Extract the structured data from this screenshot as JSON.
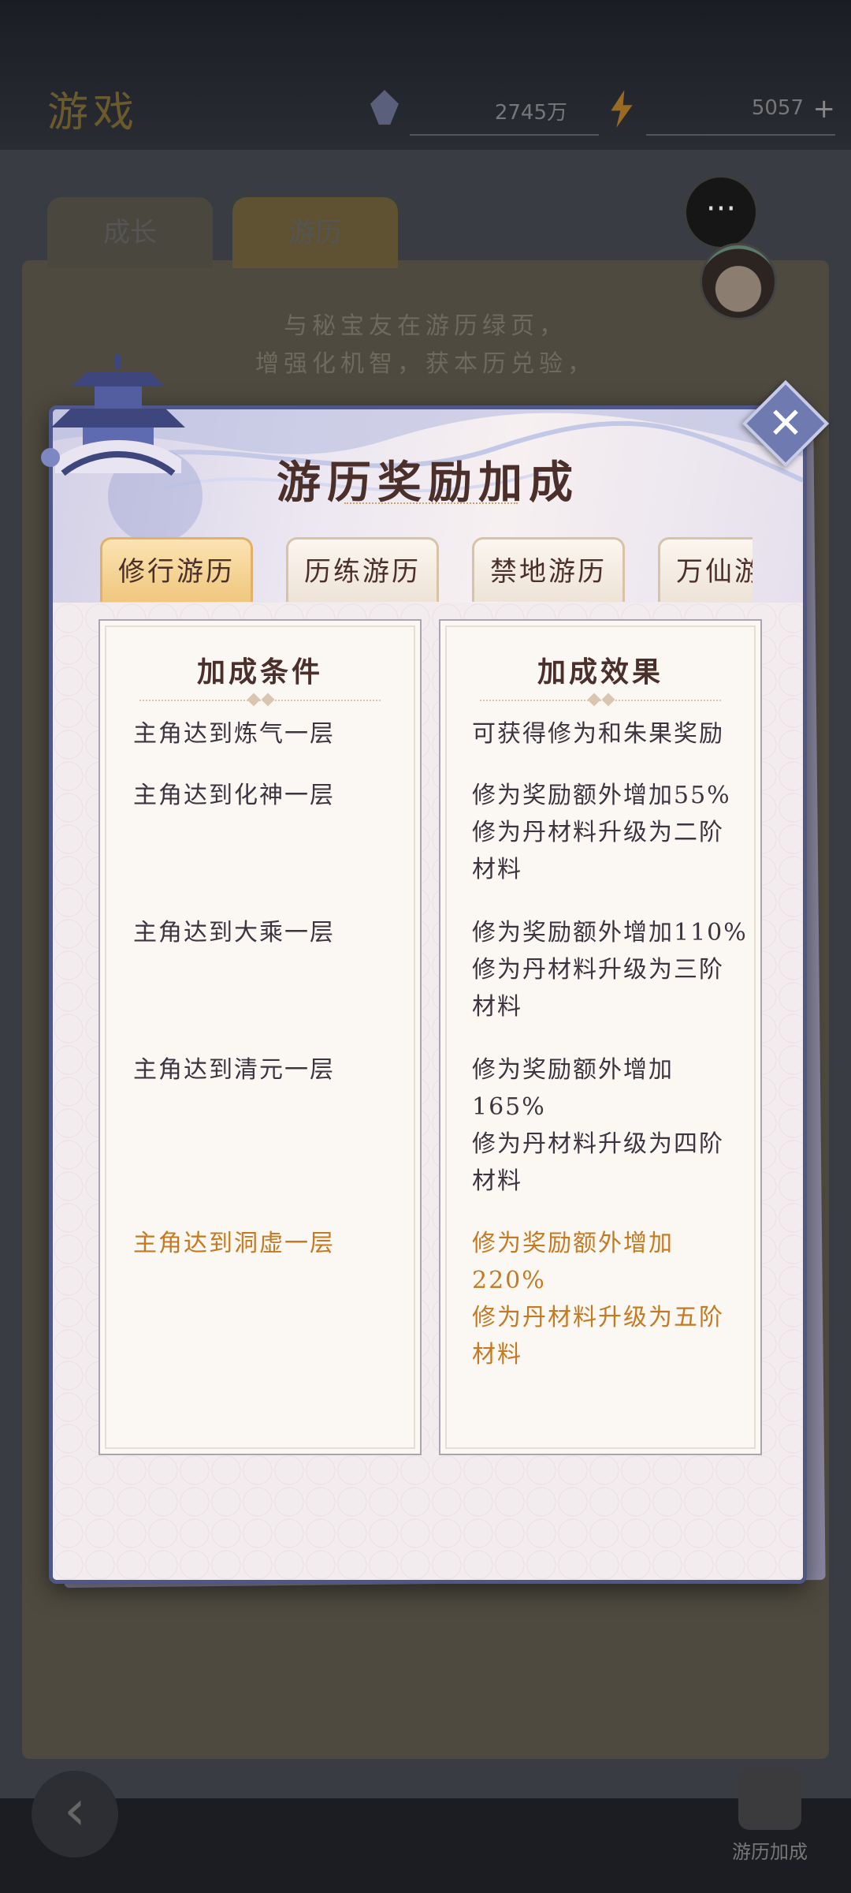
{
  "background": {
    "title": "游戏",
    "resource_1": "2745万",
    "resource_2": "5057",
    "tabs": [
      "成长",
      "游历"
    ],
    "hint_lines": [
      "与秘宝友在游历绿页，",
      "增强化机智，获本历兑验，"
    ],
    "travel_button_label": "游历加成"
  },
  "modal": {
    "title": "游历奖励加成",
    "close_icon": "close-icon",
    "tabs": [
      {
        "label": "修行游历",
        "active": true
      },
      {
        "label": "历练游历",
        "active": false
      },
      {
        "label": "禁地游历",
        "active": false
      },
      {
        "label": "万仙游历",
        "active": false
      }
    ],
    "conditions_header": "加成条件",
    "effects_header": "加成效果",
    "rows": [
      {
        "condition": "主角达到炼气一层",
        "effect": "可获得修为和朱果奖励",
        "highlight": false
      },
      {
        "condition": "主角达到化神一层",
        "effect": "修为奖励额外增加55%\n修为丹材料升级为二阶\n材料",
        "highlight": false
      },
      {
        "condition": "主角达到大乘一层",
        "effect": "修为奖励额外增加110%\n修为丹材料升级为三阶\n材料",
        "highlight": false
      },
      {
        "condition": "主角达到清元一层",
        "effect": "修为奖励额外增加\n165%\n修为丹材料升级为四阶\n材料",
        "highlight": false
      },
      {
        "condition": "主角达到洞虚一层",
        "effect": "修为奖励额外增加\n220%\n修为丹材料升级为五阶\n材料",
        "highlight": true
      }
    ]
  },
  "colors": {
    "highlight": "#c57a22",
    "text": "#3e3440",
    "frame": "#4f5688"
  }
}
